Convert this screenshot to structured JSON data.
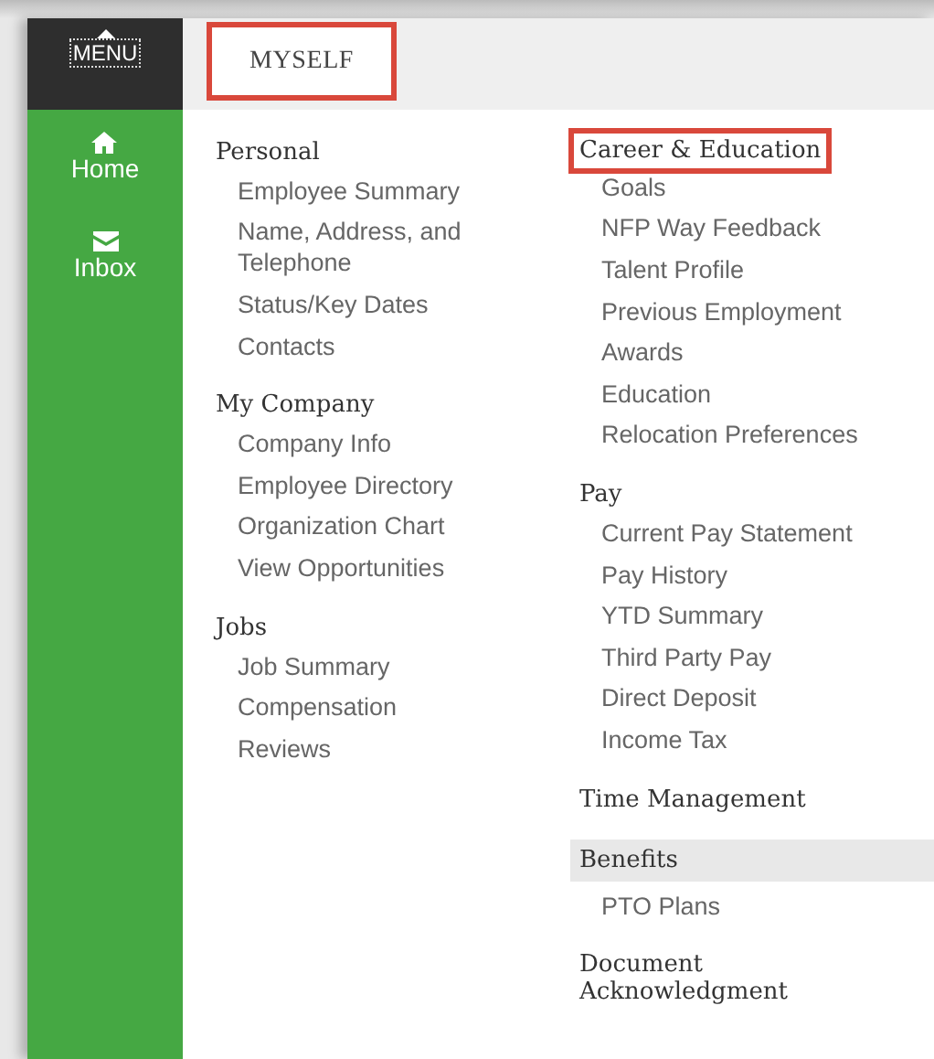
{
  "sidebar": {
    "menu_label": "MENU",
    "items": [
      {
        "kind": "home",
        "label": "Home"
      },
      {
        "kind": "inbox",
        "label": "Inbox"
      }
    ]
  },
  "tabs": [
    {
      "label": "MYSELF",
      "selected": true,
      "outlined": true
    }
  ],
  "columns": [
    {
      "sections": [
        {
          "heading": "Personal",
          "outlined": false,
          "highlighted": false,
          "items": [
            "Employee Summary",
            "Name, Address, and Telephone",
            "Status/Key Dates",
            "Contacts"
          ]
        },
        {
          "heading": "My Company",
          "outlined": false,
          "highlighted": false,
          "items": [
            "Company Info",
            "Employee Directory",
            "Organization Chart",
            "View Opportunities"
          ]
        },
        {
          "heading": "Jobs",
          "outlined": false,
          "highlighted": false,
          "items": [
            "Job Summary",
            "Compensation",
            "Reviews"
          ]
        }
      ]
    },
    {
      "sections": [
        {
          "heading": "Career & Education",
          "outlined": true,
          "highlighted": false,
          "items": [
            "Goals",
            "NFP Way Feedback",
            "Talent Profile",
            "Previous Employment",
            "Awards",
            "Education",
            "Relocation Preferences"
          ]
        },
        {
          "heading": "Pay",
          "outlined": false,
          "highlighted": false,
          "items": [
            "Current Pay Statement",
            "Pay History",
            "YTD Summary",
            "Third Party Pay",
            "Direct Deposit",
            "Income Tax"
          ]
        },
        {
          "heading": "Time Management",
          "outlined": false,
          "highlighted": false
        },
        {
          "heading": "Benefits",
          "outlined": false,
          "highlighted": true,
          "items": [
            "PTO Plans"
          ]
        },
        {
          "heading": "Document Acknowledgment",
          "outlined": false,
          "highlighted": false
        }
      ]
    }
  ]
}
